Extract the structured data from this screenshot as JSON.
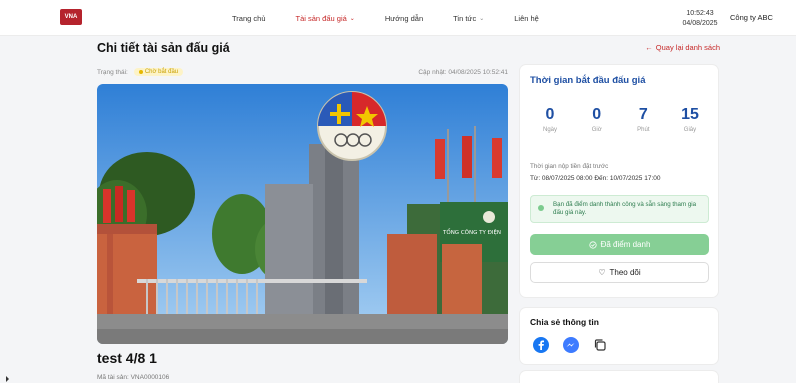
{
  "header": {
    "logo_text": "VNA",
    "nav": [
      {
        "label": "Trang chủ",
        "has_dropdown": false,
        "active": false
      },
      {
        "label": "Tài sản đấu giá",
        "has_dropdown": true,
        "active": true
      },
      {
        "label": "Hướng dẫn",
        "has_dropdown": false,
        "active": false
      },
      {
        "label": "Tin tức",
        "has_dropdown": true,
        "active": false
      },
      {
        "label": "Liên hệ",
        "has_dropdown": false,
        "active": false
      }
    ],
    "time": "10:52:43",
    "date": "04/08/2025",
    "company": "Công ty ABC"
  },
  "page": {
    "title": "Chi tiết tài sản đấu giá",
    "back_label": "Quay lại danh sách"
  },
  "status": {
    "label": "Trạng thái:",
    "badge": "Chờ bắt đầu",
    "updated": "Cập nhật: 04/08/2025 10:52:41"
  },
  "photo": {
    "sign_text": "TỔNG CÔNG TY ĐIỆN"
  },
  "asset": {
    "name": "test 4/8 1",
    "code": "Mã tài sản: VNA0000106"
  },
  "countdown": {
    "title": "Thời gian bắt đầu đấu giá",
    "values": [
      {
        "num": "0",
        "unit": "Ngày"
      },
      {
        "num": "0",
        "unit": "Giờ"
      },
      {
        "num": "7",
        "unit": "Phút"
      },
      {
        "num": "15",
        "unit": "Giây"
      }
    ],
    "deposit_label": "Thời gian nộp tiền đặt trước",
    "deposit_range": "Từ: 08/07/2025 08:00 Đến: 10/07/2025 17:00",
    "notice": "Bạn đã điểm danh thành công và sẵn sàng tham gia đấu giá này.",
    "checkin_label": "Đã điểm danh",
    "follow_label": "Theo dõi"
  },
  "share": {
    "title": "Chia sẻ thông tin"
  },
  "colors": {
    "accent_red": "#c62828",
    "primary_blue": "#1e4fa3",
    "success_green": "#86cf95"
  }
}
